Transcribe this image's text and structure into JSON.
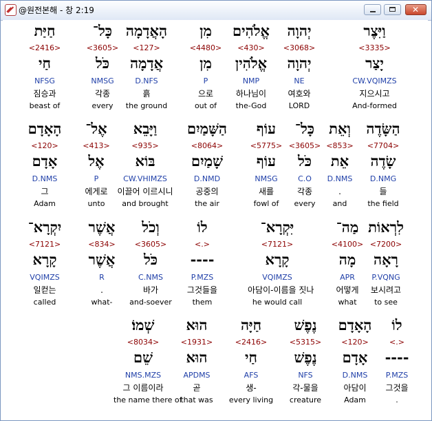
{
  "window": {
    "title": "@원전본해 - 창 2:19"
  },
  "rows": [
    {
      "words": [
        {
          "heb": "וַיִּצֶר",
          "strong": "<3335>",
          "lemma": "יָצַר",
          "parse": "CW.VQIMZS",
          "kor": "지으시고",
          "eng": "And-formed",
          "selected": true
        },
        {
          "heb": "יְהוָה",
          "strong": "<3068>",
          "lemma": "יְהוָה",
          "parse": "NE",
          "kor": "여호와",
          "eng": "LORD"
        },
        {
          "heb": "אֱלֹהִים",
          "strong": "<430>",
          "lemma": "אֱלֹהִין",
          "parse": "NMP",
          "kor": "하나님이",
          "eng": "the-God"
        },
        {
          "heb": "מִן",
          "strong": "<4480>",
          "lemma": "מִן",
          "parse": "P",
          "kor": "으로",
          "eng": "out of"
        },
        {
          "heb": "הָאֲדָמָה",
          "strong": "<127>",
          "lemma": "אֲדָמָה",
          "parse": "D.NFS",
          "kor": "흙",
          "eng": "the ground"
        },
        {
          "heb": "כָּל־",
          "strong": "<3605>",
          "lemma": "כֹּל",
          "parse": "NMSG",
          "kor": "각종",
          "eng": "every"
        },
        {
          "heb": "חַיַּת",
          "strong": "<2416>",
          "lemma": "חַי",
          "parse": "NFSG",
          "kor": "짐승과",
          "eng": "beast of"
        }
      ]
    },
    {
      "words": [
        {
          "heb": "הַשָּׂדֶה",
          "strong": "<7704>",
          "lemma": "שָׂדֶה",
          "parse": "D.NMG",
          "kor": "들",
          "eng": "the field"
        },
        {
          "heb": "וְאֵת",
          "strong": "<853>",
          "lemma": "אֵת",
          "parse": "D.NMS",
          "kor": ".",
          "eng": "and"
        },
        {
          "heb": "כָּל־",
          "strong": "<3605>",
          "lemma": "כֹּל",
          "parse": "C.O",
          "kor": "각종",
          "eng": "every"
        },
        {
          "heb": "עוֹף",
          "strong": "<5775>",
          "lemma": "עוֹף",
          "parse": "NMSG",
          "kor": "새를",
          "eng": "fowl of"
        },
        {
          "heb": "הַשָּׁמַיִם",
          "strong": "<8064>",
          "lemma": "שָׁמַיִם",
          "parse": "D.NMD",
          "kor": "공중의",
          "eng": "the air"
        },
        {
          "heb": "וַיָּבֵא",
          "strong": "<935>",
          "lemma": "בּוֹא",
          "parse": "CW.VHIMZS",
          "kor": "이끌어 이르시니",
          "eng": "and brought"
        },
        {
          "heb": "אֶל־",
          "strong": "<413>",
          "lemma": "אֶל",
          "parse": "P",
          "kor": "에게로",
          "eng": "unto"
        },
        {
          "heb": "הָאָדָם",
          "strong": "<120>",
          "lemma": "אָדָם",
          "parse": "D.NMS",
          "kor": "그",
          "eng": "Adam"
        }
      ]
    },
    {
      "words": [
        {
          "heb": "לִרְאוֹת",
          "strong": "<7200>",
          "lemma": "רָאָה",
          "parse": "P.VQNG",
          "kor": "보시려고",
          "eng": "to see"
        },
        {
          "heb": "מַה־",
          "strong": "<4100>",
          "lemma": "מָה",
          "parse": "APR",
          "kor": "어떻게",
          "eng": "what"
        },
        {
          "heb": "יִּקְרָא־",
          "strong": "<7121>",
          "lemma": "קָרָא",
          "parse": "VQIMZS",
          "kor": "아담이-이름을 짓나",
          "eng": "he would call"
        },
        {
          "heb": "לוֹ",
          "strong": "<.>",
          "lemma": "----",
          "parse": "P.MZS",
          "kor": "그것들을",
          "eng": "them"
        },
        {
          "heb": "וְכֹל",
          "strong": "<3605>",
          "lemma": "כֹּל",
          "parse": "C.NMS",
          "kor": "바가",
          "eng": "and-soever"
        },
        {
          "heb": "אֲשֶׁר",
          "strong": "<834>",
          "lemma": "אֲשֶׁר",
          "parse": "R",
          "kor": ".",
          "eng": "what-"
        },
        {
          "heb": "יִקְרָא־",
          "strong": "<7121>",
          "lemma": "קָרָא",
          "parse": "VQIMZS",
          "kor": "일컫는",
          "eng": "called"
        }
      ]
    },
    {
      "words": [
        {
          "heb": "לוֹ",
          "strong": "<.>",
          "lemma": "----",
          "parse": "P.MZS",
          "kor": "그것을",
          "eng": "."
        },
        {
          "heb": "הָאָדָם",
          "strong": "<120>",
          "lemma": "אָדָם",
          "parse": "D.NMS",
          "kor": "아담이",
          "eng": "Adam"
        },
        {
          "heb": "נֶפֶשׁ",
          "strong": "<5315>",
          "lemma": "נֶפֶשׁ",
          "parse": "NFS",
          "kor": "각-물을",
          "eng": "creature"
        },
        {
          "heb": "חַיָּה",
          "strong": "<2416>",
          "lemma": "חַי",
          "parse": "AFS",
          "kor": "생-",
          "eng": "every living"
        },
        {
          "heb": "הוּא",
          "strong": "<1931>",
          "lemma": "הוּא",
          "parse": "APDMS",
          "kor": "곧",
          "eng": "that was"
        },
        {
          "heb": "שְׁמוֹ׃",
          "strong": "<8034>",
          "lemma": "שֵׁם",
          "parse": "NMS.MZS",
          "kor": "그 이름이라",
          "eng": "the name there of"
        }
      ]
    }
  ]
}
